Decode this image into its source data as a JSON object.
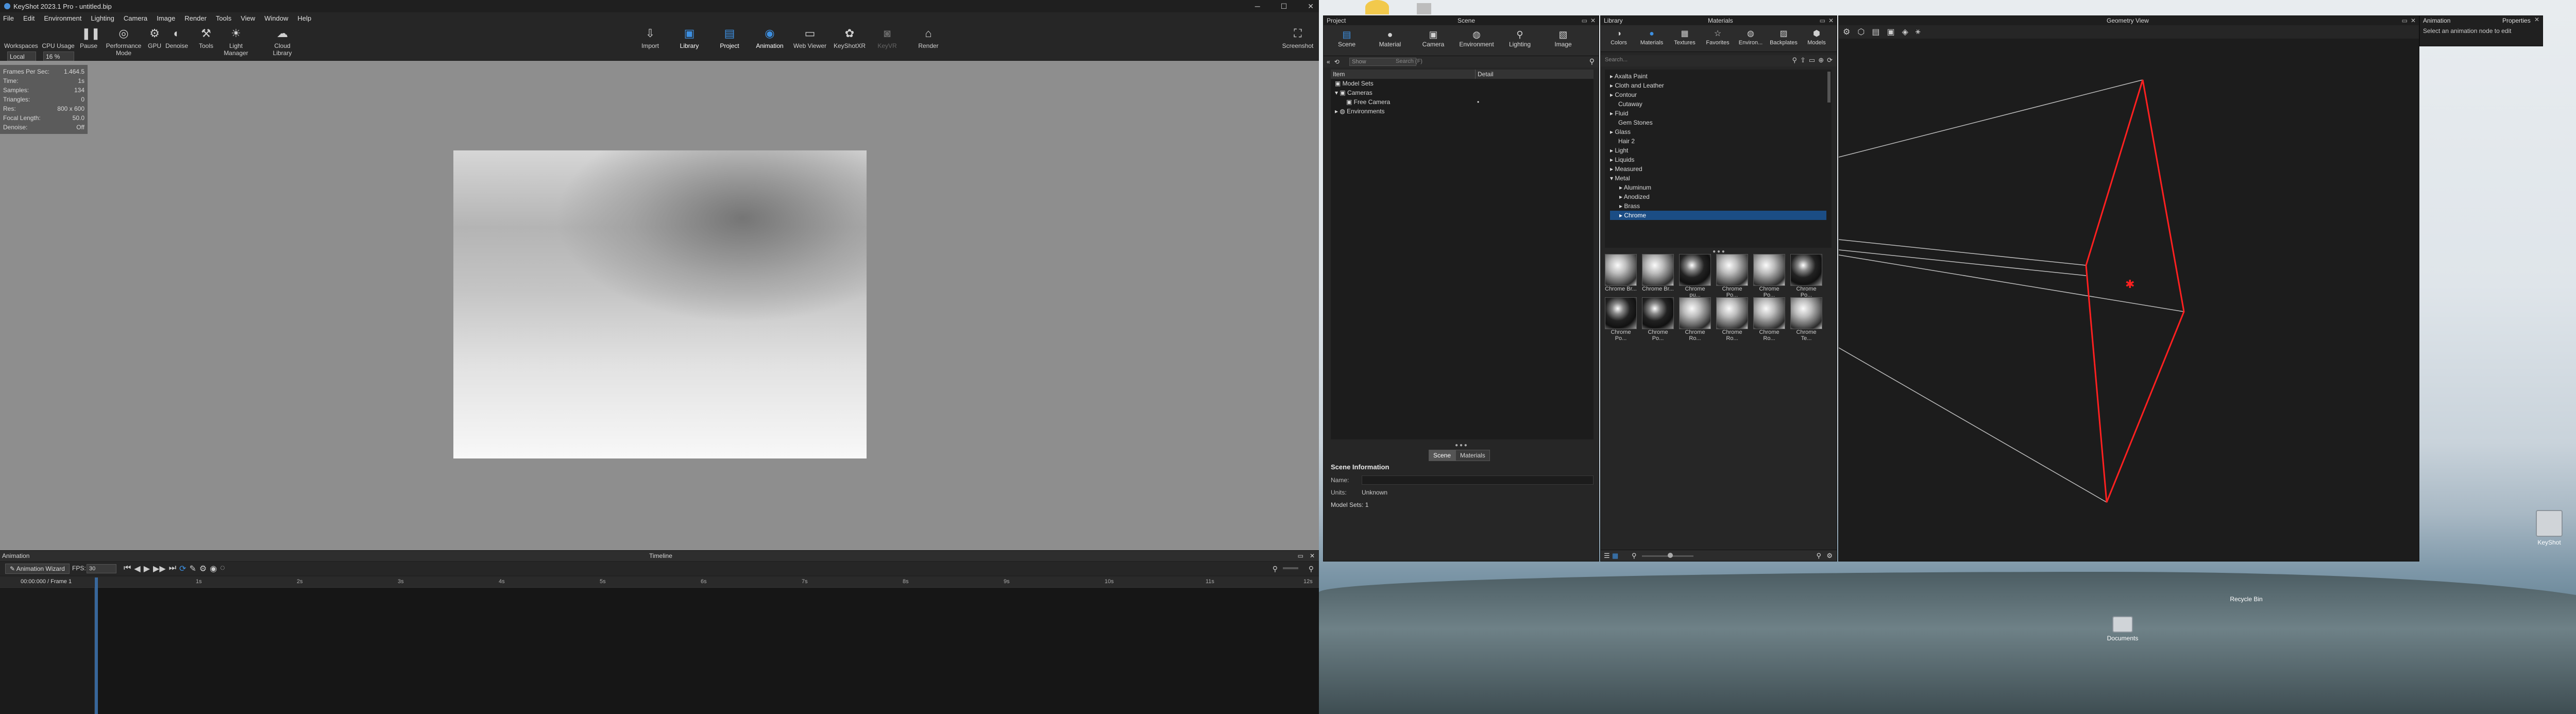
{
  "window": {
    "title": "KeyShot 2023.1 Pro - untitled.bip",
    "minimize": "─",
    "maximize": "☐",
    "close": "✕"
  },
  "menu": [
    "File",
    "Edit",
    "Environment",
    "Lighting",
    "Camera",
    "Image",
    "Render",
    "Tools",
    "View",
    "Window",
    "Help"
  ],
  "ribbon": {
    "workspace_value": "Local",
    "cpu_value": "16 %",
    "left_buttons": [
      {
        "label": "Workspaces",
        "icon": "workspaces-icon"
      },
      {
        "label": "CPU Usage",
        "icon": "cpu-icon"
      },
      {
        "label": "Pause",
        "icon": "pause-icon"
      },
      {
        "label": "Performance Mode",
        "icon": "performance-icon"
      },
      {
        "label": "GPU",
        "icon": "gpu-icon"
      },
      {
        "label": "Denoise",
        "icon": "denoise-icon"
      },
      {
        "label": "Tools",
        "icon": "tools-icon"
      },
      {
        "label": "Light Manager",
        "icon": "light-manager-icon"
      },
      {
        "label": "Cloud Library",
        "icon": "cloud-library-icon"
      }
    ],
    "right_buttons": [
      {
        "label": "Import",
        "icon": "import-icon"
      },
      {
        "label": "Library",
        "icon": "library-icon"
      },
      {
        "label": "Project",
        "icon": "project-icon"
      },
      {
        "label": "Animation",
        "icon": "animation-icon"
      },
      {
        "label": "Web Viewer",
        "icon": "web-viewer-icon"
      },
      {
        "label": "KeyShotXR",
        "icon": "keyshotxr-icon"
      },
      {
        "label": "KeyVR",
        "icon": "keyvr-icon"
      },
      {
        "label": "Render",
        "icon": "render-icon"
      }
    ],
    "screenshot": "Screenshot"
  },
  "hud": [
    {
      "k": "Frames Per Sec:",
      "v": "1.464.5"
    },
    {
      "k": "Time:",
      "v": "1s"
    },
    {
      "k": "Samples:",
      "v": "134"
    },
    {
      "k": "Triangles:",
      "v": "0"
    },
    {
      "k": "Res:",
      "v": "800 x 600"
    },
    {
      "k": "Focal Length:",
      "v": "50.0"
    },
    {
      "k": "Denoise:",
      "v": "Off"
    }
  ],
  "animation": {
    "title": "Animation",
    "timeline_title": "Timeline",
    "wizard": "Animation Wizard",
    "fps_label": "FPS:",
    "fps_value": "30",
    "frame_readout": "00:00:000 / Frame 1",
    "ticks": [
      "1s",
      "2s",
      "3s",
      "4s",
      "5s",
      "6s",
      "7s",
      "8s",
      "9s",
      "10s",
      "11s",
      "12s"
    ]
  },
  "project": {
    "title": "Project",
    "scene_title": "Scene",
    "tabs": [
      {
        "label": "Scene",
        "icon": "scene-icon"
      },
      {
        "label": "Material",
        "icon": "material-icon"
      },
      {
        "label": "Camera",
        "icon": "camera-icon"
      },
      {
        "label": "Environment",
        "icon": "environment-icon"
      },
      {
        "label": "Lighting",
        "icon": "lighting-icon"
      },
      {
        "label": "Image",
        "icon": "image-icon"
      }
    ],
    "filter_value": "Show",
    "search_placeholder": "Search (F)",
    "tree_cols": [
      "Item",
      "Detail"
    ],
    "tree": [
      {
        "label": "Model Sets",
        "indent": 0
      },
      {
        "label": "Cameras",
        "indent": 0
      },
      {
        "label": "Free Camera",
        "indent": 1,
        "detail": "•"
      },
      {
        "label": "Environments",
        "indent": 0
      }
    ],
    "seg": [
      "Scene",
      "Materials"
    ],
    "info": {
      "title": "Scene Information",
      "name_label": "Name:",
      "name_value": "",
      "units_label": "Units:",
      "units_value": "Unknown",
      "model_sets": "Model Sets: 1"
    }
  },
  "library": {
    "title": "Library",
    "materials_title": "Materials",
    "tabs": [
      {
        "label": "Colors",
        "icon": "colors-icon"
      },
      {
        "label": "Materials",
        "icon": "materials-icon"
      },
      {
        "label": "Textures",
        "icon": "textures-icon"
      },
      {
        "label": "Favorites",
        "icon": "favorites-icon"
      },
      {
        "label": "Environ...",
        "icon": "environment-icon"
      },
      {
        "label": "Backplates",
        "icon": "backplates-icon"
      },
      {
        "label": "Models",
        "icon": "models-icon"
      }
    ],
    "search_placeholder": "Search...",
    "list": [
      {
        "label": "Axalta Paint",
        "indent": 0
      },
      {
        "label": "Cloth and Leather",
        "indent": 0
      },
      {
        "label": "Contour",
        "indent": 0
      },
      {
        "label": "Cutaway",
        "indent": 0
      },
      {
        "label": "Fluid",
        "indent": 0
      },
      {
        "label": "Gem Stones",
        "indent": 0
      },
      {
        "label": "Glass",
        "indent": 0
      },
      {
        "label": "Hair 2",
        "indent": 0
      },
      {
        "label": "Light",
        "indent": 0
      },
      {
        "label": "Liquids",
        "indent": 0
      },
      {
        "label": "Measured",
        "indent": 0
      },
      {
        "label": "Metal",
        "indent": 0
      },
      {
        "label": "Aluminum",
        "indent": 1
      },
      {
        "label": "Anodized",
        "indent": 1
      },
      {
        "label": "Brass",
        "indent": 1
      },
      {
        "label": "Chrome",
        "indent": 1,
        "selected": true
      }
    ],
    "thumbs": [
      "Chrome Br...",
      "Chrome Br...",
      "Chrome pu...",
      "Chrome Po...",
      "Chrome Po...",
      "Chrome Po...",
      "Chrome Po...",
      "Chrome Po...",
      "Chrome Ro...",
      "Chrome Ro...",
      "Chrome Ro...",
      "Chrome Te..."
    ]
  },
  "geometry": {
    "title": "Geometry View"
  },
  "properties": {
    "animation_title": "Animation",
    "title": "Properties",
    "hint": "Select an animation node to edit"
  },
  "desktop": {
    "icons": [
      {
        "label": "KeyShot"
      },
      {
        "label": "Recycle Bin"
      },
      {
        "label": "Documents"
      }
    ]
  },
  "colors": {
    "accent": "#3d8fe0",
    "geometry_lines": "#ff2020",
    "selection": "#1b4d85"
  }
}
